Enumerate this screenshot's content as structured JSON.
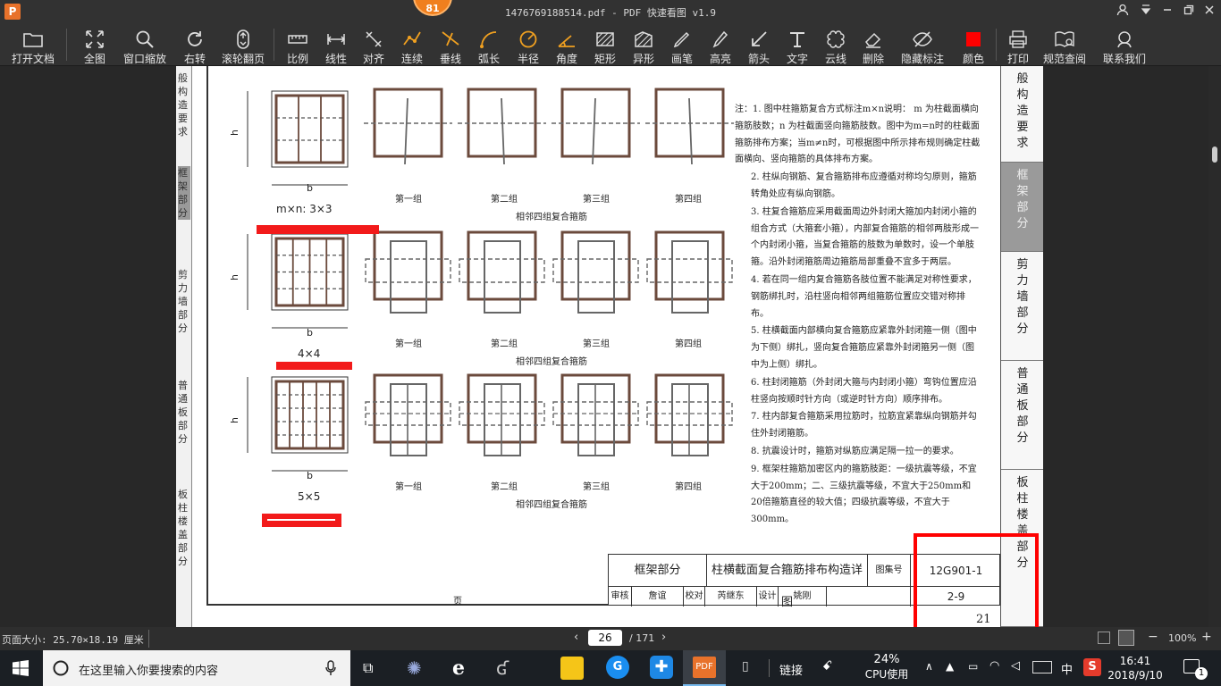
{
  "titlebar": {
    "filename": "1476769188514.pdf",
    "app": "PDF 快速看图 v1.9",
    "badge": "81"
  },
  "toolbar": {
    "items": [
      {
        "label": "打开文档",
        "icon": "folder-icon"
      },
      {
        "label": "全图",
        "icon": "fit-page-icon"
      },
      {
        "label": "窗口缩放",
        "icon": "magnifier-icon"
      },
      {
        "label": "右转",
        "icon": "rotate-icon"
      },
      {
        "label": "滚轮翻页",
        "icon": "mouse-icon"
      },
      {
        "label": "比例",
        "icon": "ruler-icon"
      },
      {
        "label": "线性",
        "icon": "linear-dim-icon"
      },
      {
        "label": "对齐",
        "icon": "aligned-dim-icon"
      },
      {
        "label": "连续",
        "icon": "continuous-dim-icon"
      },
      {
        "label": "垂线",
        "icon": "perpendicular-icon"
      },
      {
        "label": "弧长",
        "icon": "arc-icon"
      },
      {
        "label": "半径",
        "icon": "radius-icon"
      },
      {
        "label": "角度",
        "icon": "angle-icon"
      },
      {
        "label": "矩形",
        "icon": "rectangle-area-icon"
      },
      {
        "label": "异形",
        "icon": "polygon-area-icon"
      },
      {
        "label": "画笔",
        "icon": "pen-icon"
      },
      {
        "label": "高亮",
        "icon": "highlighter-icon"
      },
      {
        "label": "箭头",
        "icon": "arrow-icon"
      },
      {
        "label": "文字",
        "icon": "text-icon"
      },
      {
        "label": "云线",
        "icon": "cloud-icon"
      },
      {
        "label": "删除",
        "icon": "eraser-icon"
      },
      {
        "label": "隐藏标注",
        "icon": "eye-hide-icon"
      },
      {
        "label": "颜色",
        "icon": "color-swatch-icon"
      },
      {
        "label": "打印",
        "icon": "printer-icon"
      },
      {
        "label": "规范查阅",
        "icon": "book-icon"
      },
      {
        "label": "联系我们",
        "icon": "support-icon"
      }
    ],
    "accent": "#f0a020",
    "swatch_color": "#ff0000"
  },
  "page": {
    "left_tabs": [
      "般构造要求",
      "框架部分",
      "剪力墙部分",
      "普通板部分",
      "板柱楼盖部分"
    ],
    "right_tabs": [
      "般构造要求",
      "框架部分",
      "剪力墙部分",
      "普通板部分",
      "板柱楼盖部分"
    ],
    "rows": [
      {
        "size": "m×n: 3×3",
        "caption": "相邻四组复合箍筋"
      },
      {
        "size": "4×4",
        "caption": "相邻四组复合箍筋"
      },
      {
        "size": "5×5",
        "caption": "相邻四组复合箍筋"
      }
    ],
    "groups": [
      "第一组",
      "第二组",
      "第三组",
      "第四组"
    ],
    "dim_b": "b",
    "dim_h": "h",
    "notes": [
      "注：1. 图中柱箍筋复合方式标注m×n说明： m 为柱截面横向箍筋肢数；n 为柱截面竖向箍筋肢数。图中为m=n时的柱截面箍筋排布方案；当m≠n时，可根据图中所示排布规则确定柱截面横向、竖向箍筋的具体排布方案。",
      "2. 柱纵向钢筋、复合箍筋排布应遵循对称均匀原则，箍筋转角处应有纵向钢筋。",
      "3. 柱复合箍筋应采用截面周边外封闭大箍加内封闭小箍的组合方式（大箍套小箍），内部复合箍筋的相邻两肢形成一个内封闭小箍，当复合箍筋的肢数为单数时，设一个单肢箍。沿外封闭箍筋周边箍筋局部重叠不宜多于两层。",
      "4. 若在同一组内复合箍筋各肢位置不能满足对称性要求，钢筋绑扎时，沿柱竖向相邻两组箍筋位置应交错对称排布。",
      "5. 柱横截面内部横向复合箍筋应紧靠外封闭箍一侧（图中为下侧）绑扎，竖向复合箍筋应紧靠外封闭箍另一侧（图中为上侧）绑扎。",
      "6. 柱封闭箍筋（外封闭大箍与内封闭小箍）弯钩位置应沿柱竖向按顺时针方向（或逆时针方向）顺序排布。",
      "7. 柱内部复合箍筋采用拉筋时，拉筋宜紧靠纵向钢筋并勾住外封闭箍筋。",
      "8. 抗震设计时，箍筋对纵筋应满足隔一拉一的要求。",
      "9. 框架柱箍筋加密区内的箍筋肢距：一级抗震等级，不宜大于200mm；二、三级抗震等级，不宜大于250mm和20倍箍筋直径的较大值；四级抗震等级，不宜大于300mm。"
    ],
    "titleblock": {
      "section": "框架部分",
      "title": "柱横截面复合箍筋排布构造详图",
      "atlas_label": "图集号",
      "atlas_no": "12G901-1",
      "page_label": "页",
      "page_no": "2-9",
      "sign_row": [
        "审核",
        "詹谊",
        "校对",
        "芮继东",
        "设计",
        "姚刚"
      ],
      "sheet_no": "21"
    }
  },
  "statusbar": {
    "page_size": "页面大小: 25.70×18.19 厘米",
    "current_page": "26",
    "total_pages": "/ 171",
    "zoom": "100%"
  },
  "taskbar": {
    "search_placeholder": "在这里输入你要搜索的内容",
    "link_label": "链接",
    "cpu_percent": "24%",
    "cpu_label": "CPU使用",
    "ime": "中",
    "time": "16:41",
    "date": "2018/9/10",
    "notify_count": "1"
  }
}
